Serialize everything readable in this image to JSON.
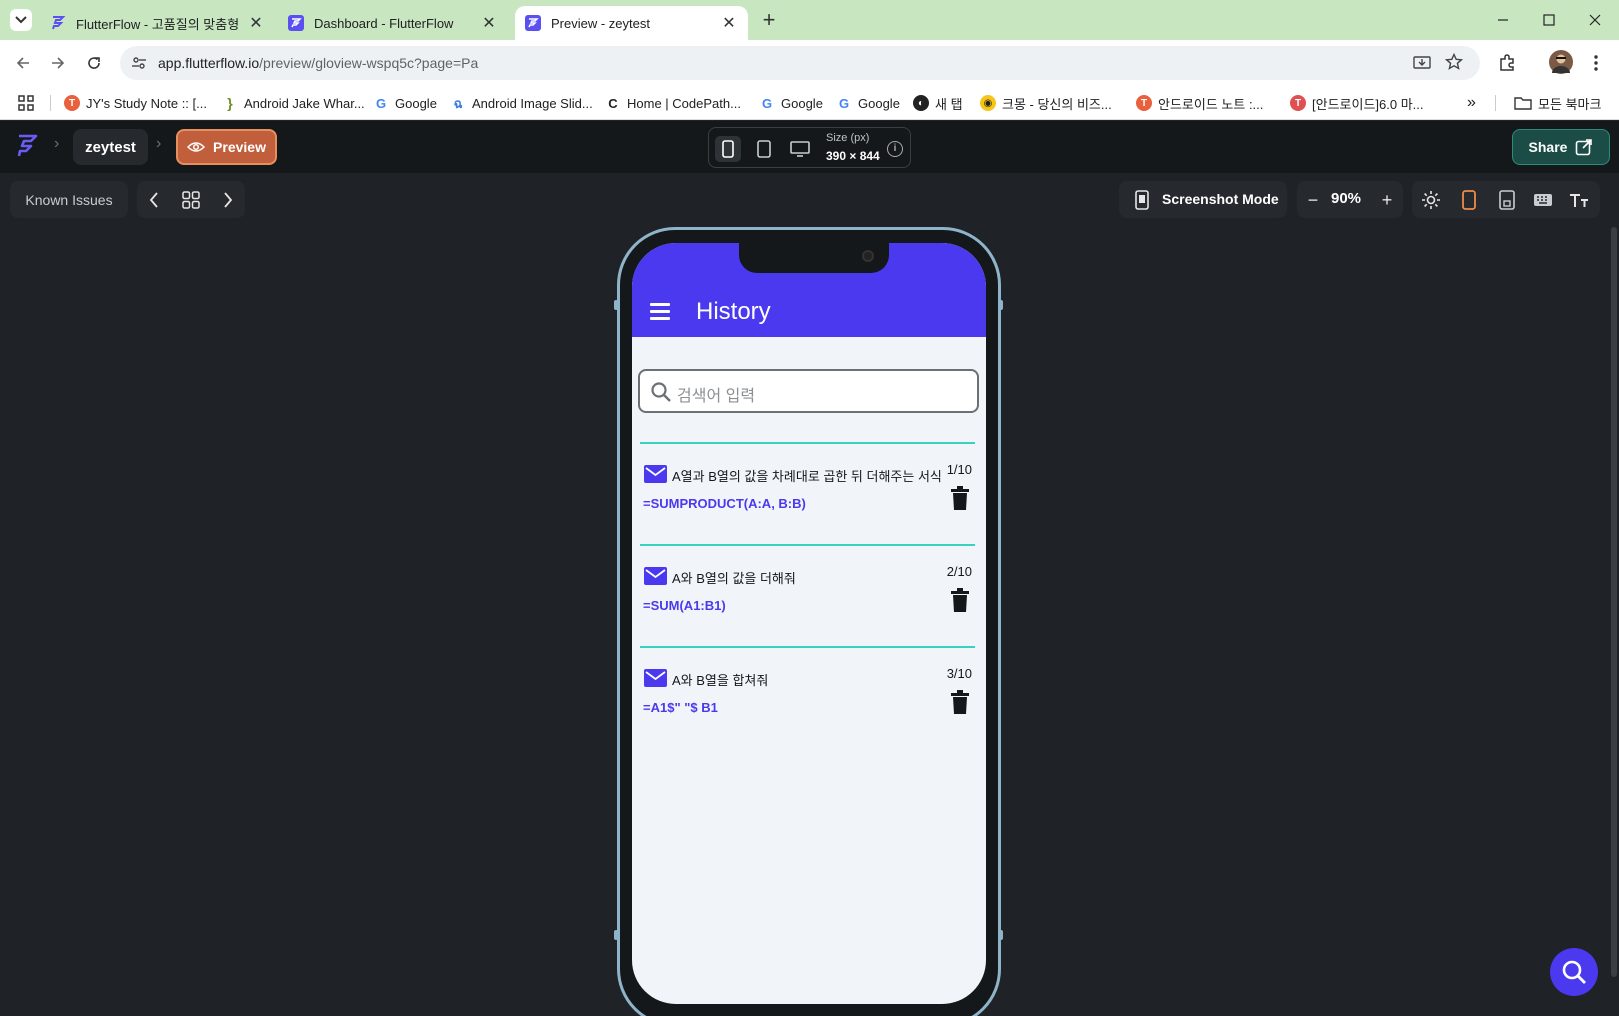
{
  "browser": {
    "tabs": [
      {
        "title": "FlutterFlow - 고품질의 맞춤형",
        "active": false
      },
      {
        "title": "Dashboard - FlutterFlow",
        "active": false
      },
      {
        "title": "Preview - zeytest",
        "active": true
      }
    ],
    "url_host": "app.flutterflow.io",
    "url_path": "/preview/gloview-wspq5c?page=Pa",
    "bookmarks": [
      {
        "label": "JY's Study Note :: [...",
        "icon": "tistory-icon",
        "color": "#e8603c"
      },
      {
        "label": "Android Jake Whar...",
        "icon": "bookmark-icon",
        "color": "#6b8e23"
      },
      {
        "label": "Google",
        "icon": "google-icon",
        "color": "#4285f4"
      },
      {
        "label": "Android Image Slid...",
        "icon": "github-icon",
        "color": "#3b7ddd"
      },
      {
        "label": "Home | CodePath...",
        "icon": "codepath-icon",
        "color": "#222222"
      },
      {
        "label": "Google",
        "icon": "google-icon",
        "color": "#4285f4"
      },
      {
        "label": "Google",
        "icon": "google-icon",
        "color": "#4285f4"
      },
      {
        "label": "새 탭",
        "icon": "globe-icon",
        "color": "#222222"
      },
      {
        "label": "크몽 - 당신의 비즈...",
        "icon": "kmong-icon",
        "color": "#f5c518"
      },
      {
        "label": "안드로이드 노트 :...",
        "icon": "tistory-icon",
        "color": "#e8603c"
      },
      {
        "label": "[안드로이드]6.0 마...",
        "icon": "tistory-icon",
        "color": "#e05050"
      }
    ],
    "overflow_label": "»",
    "all_bookmarks_label": "모든 북마크"
  },
  "ff": {
    "project_name": "zeytest",
    "preview_label": "Preview",
    "size_label": "Size (px)",
    "size_value": "390 × 844",
    "share_label": "Share",
    "known_issues_label": "Known Issues",
    "screenshot_mode_label": "Screenshot Mode",
    "zoom_label": "90%",
    "zoom_minus": "−",
    "zoom_plus": "+"
  },
  "app": {
    "title": "History",
    "search_placeholder": "검색어 입력",
    "items": [
      {
        "question": "A열과 B열의 값을 차례대로 곱한 뒤 더해주는 서식",
        "formula": "=SUMPRODUCT(A:A, B:B)",
        "index": "1/10"
      },
      {
        "question": "A와 B열의 값을 더해줘",
        "formula": "=SUM(A1:B1)",
        "index": "2/10"
      },
      {
        "question": "A와 B열을 합쳐줘",
        "formula": "=A1$\" \"$ B1",
        "index": "3/10"
      }
    ]
  },
  "colors": {
    "primary": "#4b39ef",
    "divider": "#39d2c0",
    "preview_button": "#c15f3c",
    "share_button": "#1b4d46"
  }
}
